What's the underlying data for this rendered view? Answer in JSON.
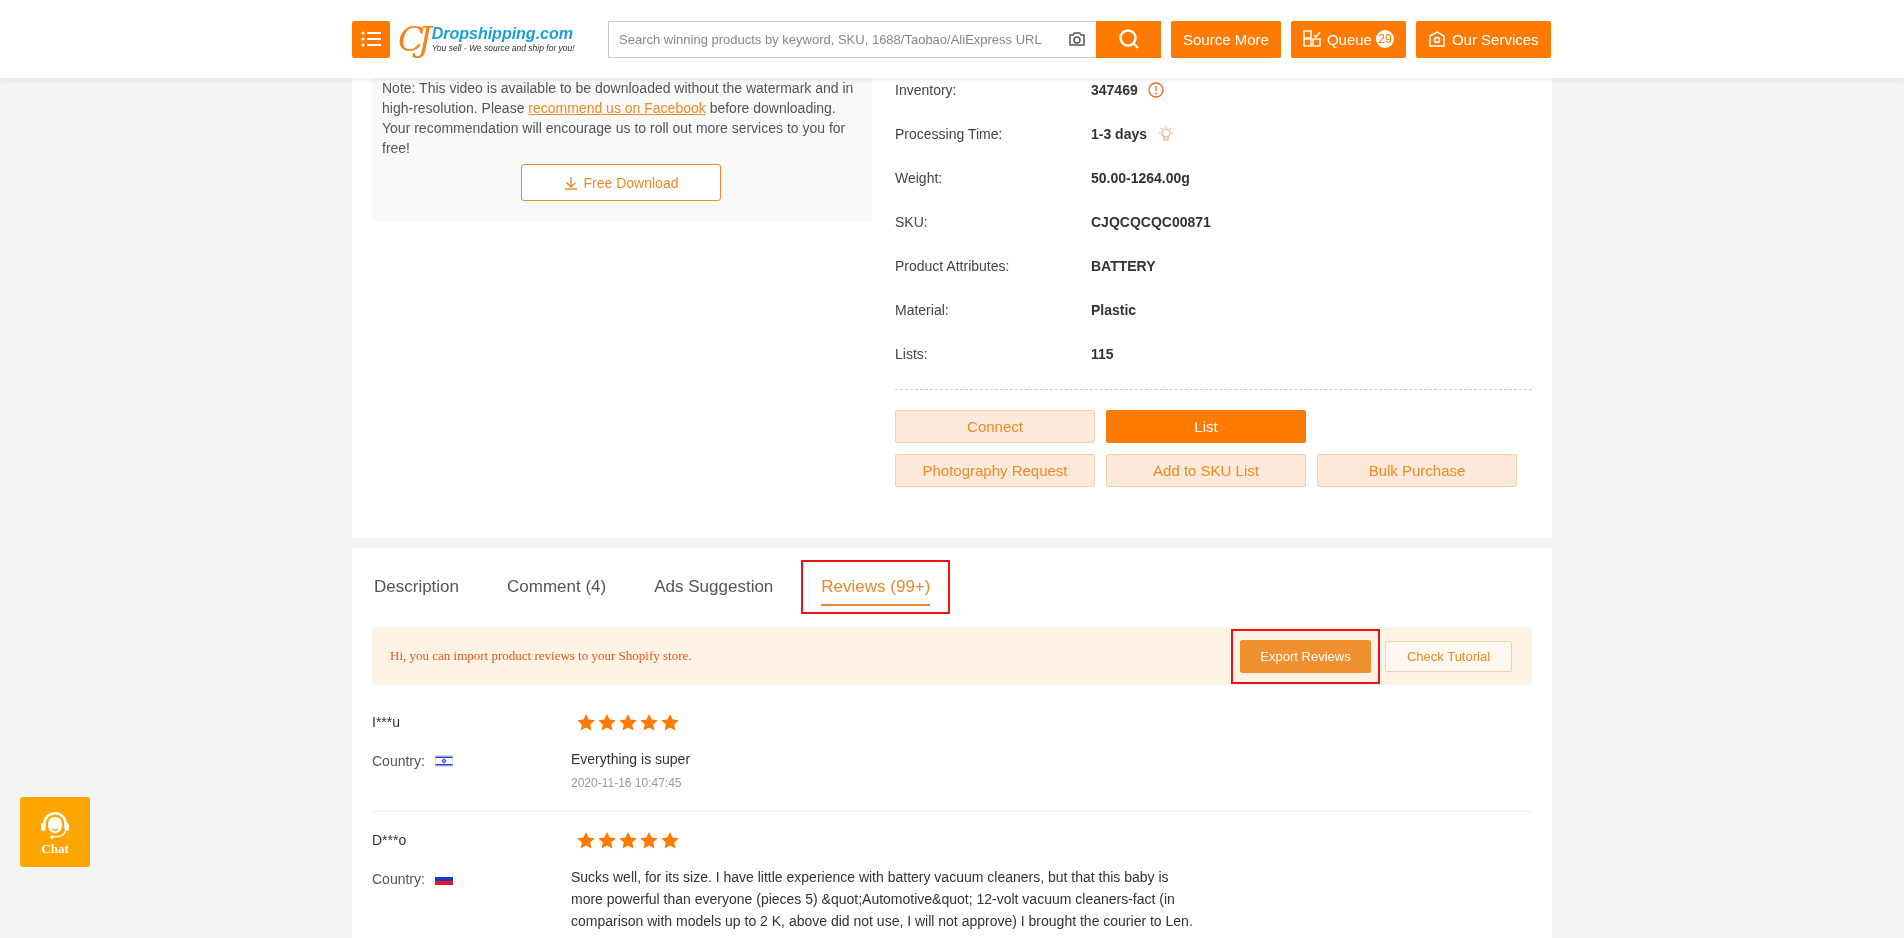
{
  "header": {
    "logo_mark": "CJ",
    "logo_title": "Dropshipping.com",
    "logo_tagline": "You sell - We source and ship for you!",
    "search": {
      "placeholder": "Search winning products by keyword, SKU, 1688/Taobao/AliExpress URL"
    },
    "buttons": [
      {
        "kind": "text",
        "label": "Source More"
      },
      {
        "kind": "queue",
        "label": "Queue",
        "badge": "29"
      },
      {
        "kind": "services",
        "label": "Our Services"
      }
    ]
  },
  "video_note": {
    "text_before": "Note: This video is available to be downloaded without the watermark and in high-resolution. Please ",
    "link": "recommend us on Facebook",
    "text_after": " before downloading. Your recommendation will encourage us to roll out more services to you for free!",
    "button": "Free Download"
  },
  "details": [
    {
      "label": "Inventory:",
      "value": "347469",
      "kind": "alert"
    },
    {
      "label": "Processing Time:",
      "value": "1-3 days",
      "kind": "tip"
    },
    {
      "label": "Weight:",
      "value": "50.00-1264.00g",
      "kind": "plain"
    },
    {
      "label": "SKU:",
      "value": "CJQCQCQC00871",
      "kind": "plain"
    },
    {
      "label": "Product Attributes:",
      "value": "BATTERY",
      "kind": "plain"
    },
    {
      "label": "Material:",
      "value": "Plastic",
      "kind": "plain"
    },
    {
      "label": "Lists:",
      "value": "115",
      "kind": "plain"
    }
  ],
  "actions": [
    [
      {
        "label": "Connect",
        "primary": false
      },
      {
        "label": "List",
        "primary": true
      }
    ],
    [
      {
        "label": "Photography Request",
        "primary": false
      },
      {
        "label": "Add to SKU List",
        "primary": false
      },
      {
        "label": "Bulk Purchase",
        "primary": false
      }
    ]
  ],
  "tabs": [
    {
      "label": "Description",
      "selected": false,
      "highlighted": false
    },
    {
      "label": "Comment (4)",
      "selected": false,
      "highlighted": false
    },
    {
      "label": "Ads Suggestion",
      "selected": false,
      "highlighted": false
    },
    {
      "label": "Reviews (99+)",
      "selected": true,
      "highlighted": true
    }
  ],
  "banner": {
    "text": "Hi, you can import product reviews to your Shopify store.",
    "buttons": [
      {
        "label": "Export Reviews",
        "primary": true,
        "highlighted": true
      },
      {
        "label": "Check Tutorial",
        "primary": false,
        "highlighted": false
      }
    ]
  },
  "reviews": [
    {
      "name": "I***u",
      "country_label": "Country:",
      "kind": "israel",
      "stars": 5,
      "text": "Everything is super",
      "date": "2020-11-16 10:47:45"
    },
    {
      "name": "D***o",
      "country_label": "Country:",
      "kind": "russia",
      "stars": 5,
      "text": "Sucks well, for its size. I have little experience with battery vacuum cleaners, but that this baby is more powerful than everyone (pieces 5) &quot;Automotive&quot; 12-volt vacuum cleaners-fact (in comparison with models up to 2 K, above did not use, I will not approve) I brought the courier to Len."
    }
  ],
  "chat": {
    "label": "Chat"
  }
}
